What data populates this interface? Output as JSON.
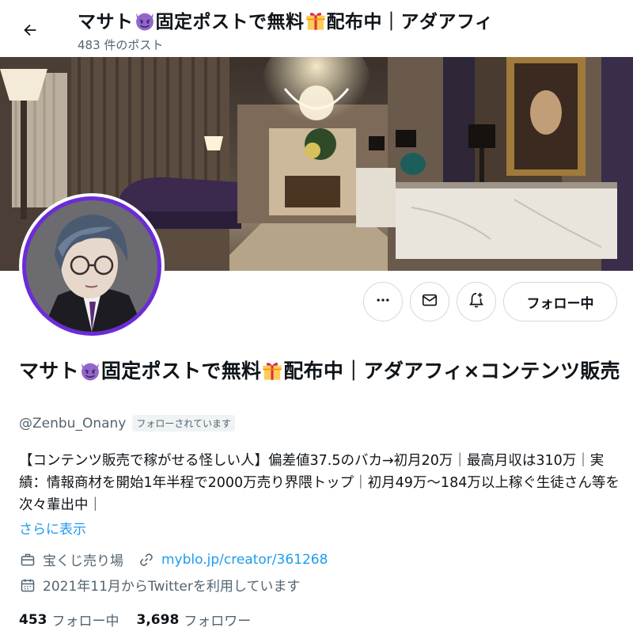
{
  "header": {
    "title_pre": "マサト",
    "title_mid": "固定ポストで無料",
    "title_post": "配布中｜アダアフィ",
    "post_count": "483 件のポスト"
  },
  "profile": {
    "name_pre": "マサト",
    "name_mid": "固定ポストで無料",
    "name_post": "配布中｜アダアフィ×コンテンツ販売",
    "handle": "@Zenbu_Onany",
    "follows_you": "フォローされています",
    "bio": "【コンテンツ販売で稼がせる怪しい人】偏差値37.5のバカ→初月20万｜最高月収は310万｜実績：情報商材を開始1年半程で2000万売り界隈トップ｜初月49万〜184万以上稼ぐ生徒さん等を次々輩出中｜",
    "show_more": "さらに表示",
    "category": "宝くじ売り場",
    "website": "myblo.jp/creator/361268",
    "joined": "2021年11月からTwitterを利用しています",
    "following_count": "453",
    "following_label": "フォロー中",
    "followers_count": "3,698",
    "followers_label": "フォロワー"
  },
  "actions": {
    "follow_label": "フォロー中"
  },
  "icons": {
    "back": "arrow-left-icon",
    "more": "more-icon",
    "message": "envelope-icon",
    "notify": "bell-plus-icon",
    "category": "briefcase-icon",
    "link": "link-icon",
    "calendar": "calendar-icon",
    "devil": "smiling-imp-emoji",
    "gift": "gift-emoji"
  },
  "colors": {
    "accent": "#1d9bf0",
    "text_secondary": "#536471",
    "avatar_ring": "#6c2bd9"
  }
}
